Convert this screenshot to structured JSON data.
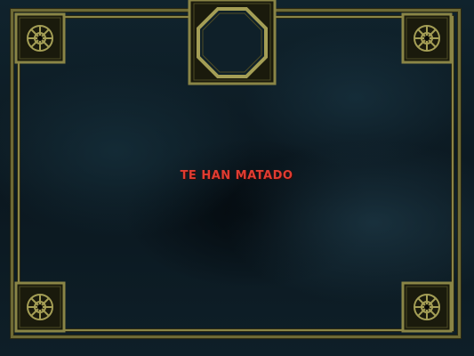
{
  "screen": {
    "message": "TE HAN MATADO"
  },
  "hud": {
    "corner_ornament_icon": "star-rosette-icon",
    "portrait_slot_icon": "octagon-portrait-frame-icon"
  },
  "colors": {
    "background": "#0c1a22",
    "frame_gold": "#8a8546",
    "message_red": "#e03c32"
  }
}
